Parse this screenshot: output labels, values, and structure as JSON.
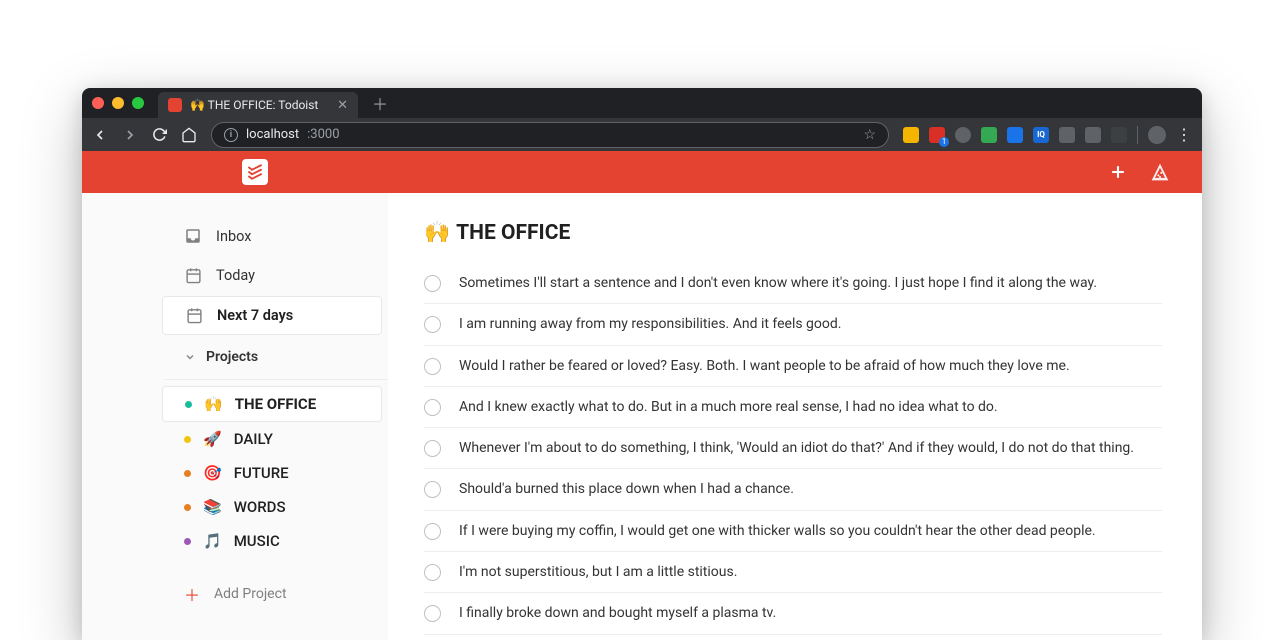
{
  "browser": {
    "tab_title": "🙌 THE OFFICE: Todoist",
    "url_host": "localhost",
    "url_path": ":3000"
  },
  "header": {
    "add_label": "+",
    "pizza_label": "🍕"
  },
  "sidebar": {
    "inbox": "Inbox",
    "today": "Today",
    "next7": "Next 7 days",
    "projects_header": "Projects",
    "projects": [
      {
        "emoji": "🙌",
        "name": "THE OFFICE",
        "dot": "d-teal",
        "active": true
      },
      {
        "emoji": "🚀",
        "name": "DAILY",
        "dot": "d-yel",
        "active": false
      },
      {
        "emoji": "🎯",
        "name": "FUTURE",
        "dot": "d-ora",
        "active": false
      },
      {
        "emoji": "📚",
        "name": "WORDS",
        "dot": "d-ora2",
        "active": false
      },
      {
        "emoji": "🎵",
        "name": "MUSIC",
        "dot": "d-pur",
        "active": false
      }
    ],
    "add_project": "Add Project"
  },
  "main": {
    "title_emoji": "🙌",
    "title_text": "THE OFFICE",
    "tasks": [
      "Sometimes I'll start a sentence and I don't even know where it's going. I just hope I find it along the way.",
      "I am running away from my responsibilities. And it feels good.",
      "Would I rather be feared or loved? Easy. Both. I want people to be afraid of how much they love me.",
      "And I knew exactly what to do. But in a much more real sense, I had no idea what to do.",
      "Whenever I'm about to do something, I think, 'Would an idiot do that?' And if they would, I do not do that thing.",
      "Should'a burned this place down when I had a chance.",
      "If I were buying my coffin, I would get one with thicker walls so you couldn't hear the other dead people.",
      "I'm not superstitious, but I am a little stitious.",
      "I finally broke down and bought myself a plasma tv."
    ]
  }
}
